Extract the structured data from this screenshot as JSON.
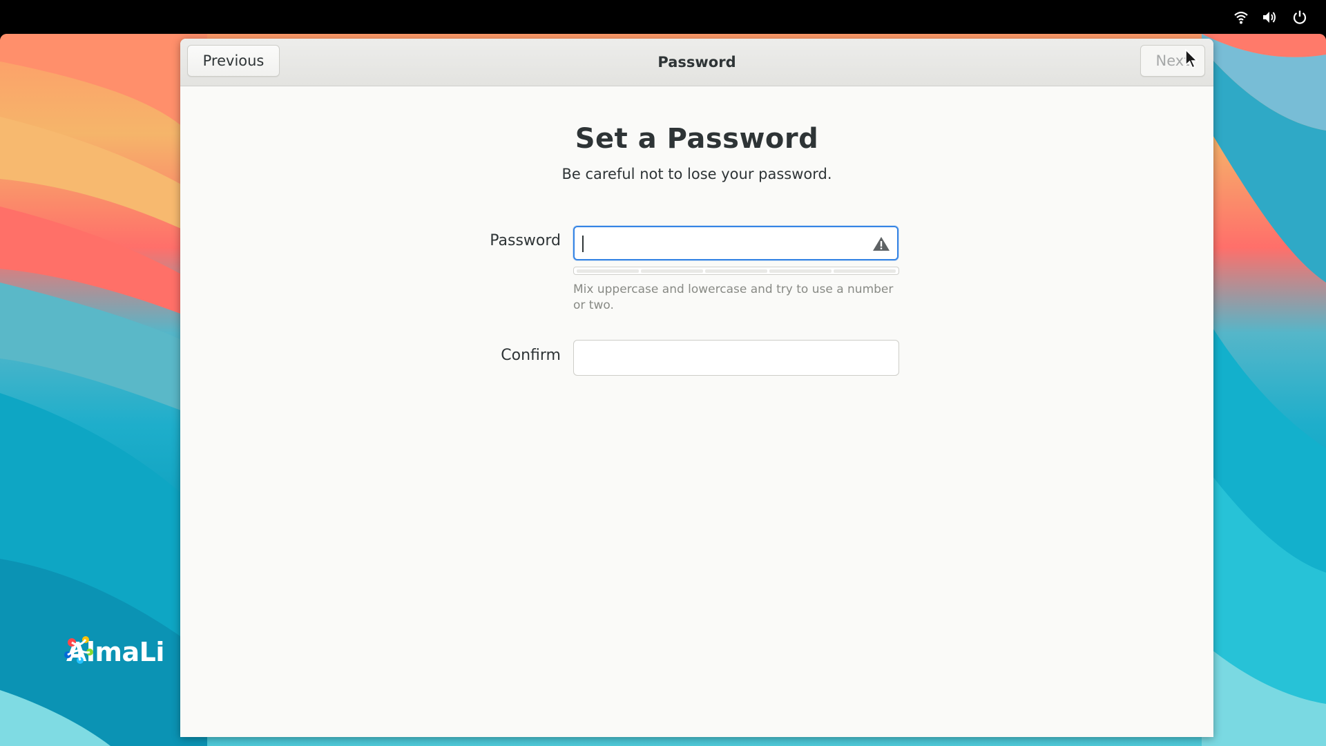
{
  "system_tray": {
    "icons": [
      "wifi-icon",
      "volume-icon",
      "power-icon"
    ]
  },
  "desktop": {
    "logo_text": "AlmaLi"
  },
  "window": {
    "title": "Password",
    "previous_label": "Previous",
    "next_label": "Next",
    "next_enabled": false
  },
  "page": {
    "heading": "Set a Password",
    "subtitle": "Be careful not to lose your password."
  },
  "form": {
    "password_label": "Password",
    "password_value": "",
    "password_status_icon": "warning-icon",
    "strength_level": 0,
    "strength_segments": 5,
    "hint": "Mix uppercase and lowercase and try to use a number or two.",
    "confirm_label": "Confirm",
    "confirm_value": ""
  },
  "colors": {
    "accent": "#3584e4",
    "window_bg": "#fafaf8",
    "text": "#2e3436",
    "hint_text": "#888a85"
  }
}
